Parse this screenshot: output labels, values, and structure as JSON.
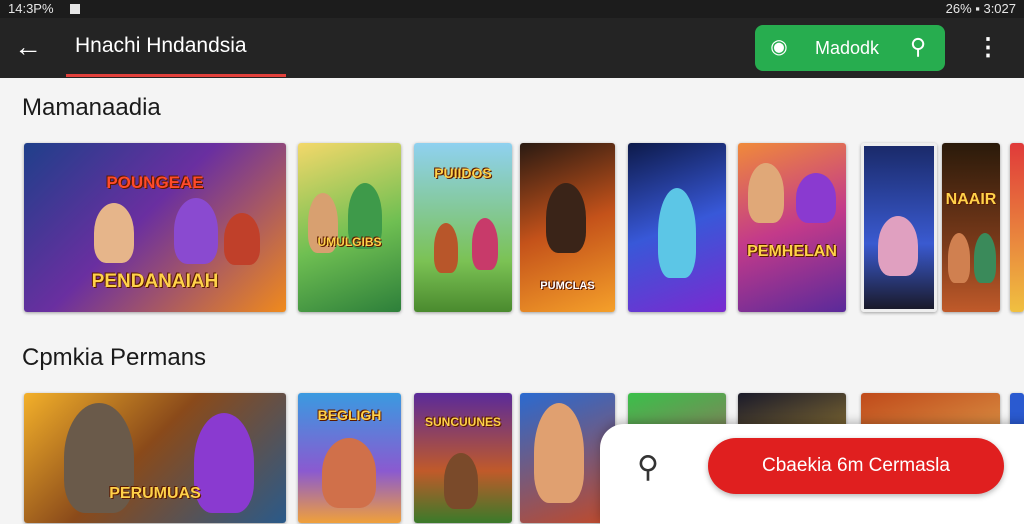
{
  "status_bar": {
    "left": "14:3P%",
    "right": "26% ▪ 3:027"
  },
  "app_bar": {
    "back_icon": "arrow-back-icon",
    "title": "Hnachi Hndandsia",
    "chip": {
      "label": "Madodk",
      "left_icon": "gamepad-icon",
      "right_icon": "search-icon"
    },
    "menu_icon": "more-vert-icon"
  },
  "sections": [
    {
      "title": "Mamanaadia",
      "tiles": [
        {
          "label": "PENDANAIAH",
          "top_label": "POUNGEAE"
        },
        {
          "label": "UMULGIBS"
        },
        {
          "label": "PUIIDOS"
        },
        {
          "label": "PUMCLAS"
        },
        {
          "label": ""
        },
        {
          "label": "PEMHELAN"
        },
        {
          "label": ""
        },
        {
          "label": "NAAIR"
        },
        {
          "label": ""
        }
      ]
    },
    {
      "title": "Cpmkia Permans",
      "tiles": [
        {
          "label": "PERUMUAS"
        },
        {
          "label": "BEGLIGH"
        },
        {
          "label": "SUNCUUNES"
        },
        {
          "label": ""
        },
        {
          "label": ""
        },
        {
          "label": ""
        },
        {
          "label": ""
        },
        {
          "label": ""
        }
      ]
    }
  ],
  "bottom": {
    "search_icon": "search-icon",
    "cta_label": "Cbaekia 6m Cermasla"
  },
  "colors": {
    "appbar": "#242424",
    "chip": "#27ad4f",
    "cta": "#e01f1f",
    "underline": "#e2403b"
  }
}
